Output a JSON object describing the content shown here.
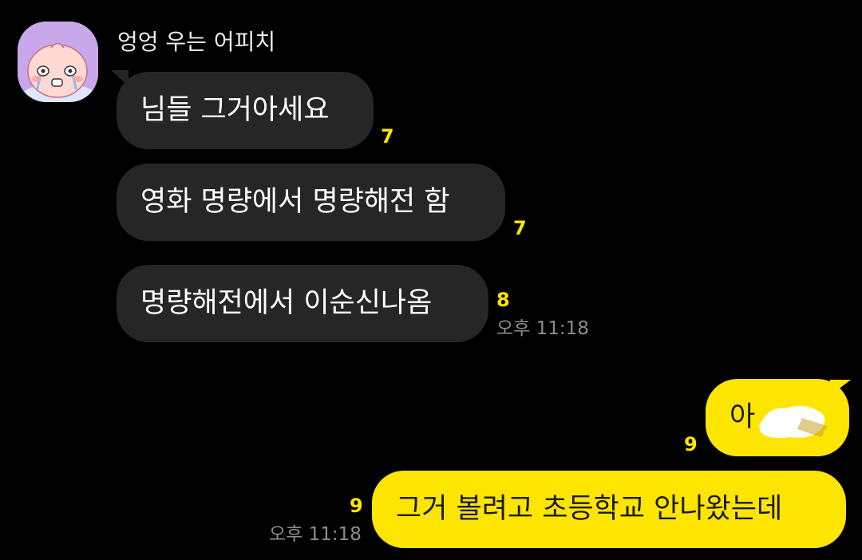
{
  "conversation": {
    "sender_name": "엉엉 우는 어피치",
    "avatar_icon": "crying-apeach-avatar",
    "incoming": [
      {
        "text": "님들 그거아세요",
        "unread": "7"
      },
      {
        "text": "영화 명량에서 명량해전 함",
        "unread": "7"
      },
      {
        "text": "명량해전에서 이순신나옴",
        "unread": "8",
        "time": "오후 11:18"
      }
    ],
    "outgoing": [
      {
        "text": "아",
        "unread": "9",
        "redacted": true
      },
      {
        "text": "그거 볼려고 초등학교 안나왔는데",
        "unread": "9",
        "time": "오후 11:18"
      }
    ]
  },
  "colors": {
    "background": "#000000",
    "incoming_bubble": "#262626",
    "outgoing_bubble": "#fee500",
    "unread_count": "#fee500",
    "timestamp": "#8c8c8c",
    "avatar_background": "#c8a8ea"
  }
}
